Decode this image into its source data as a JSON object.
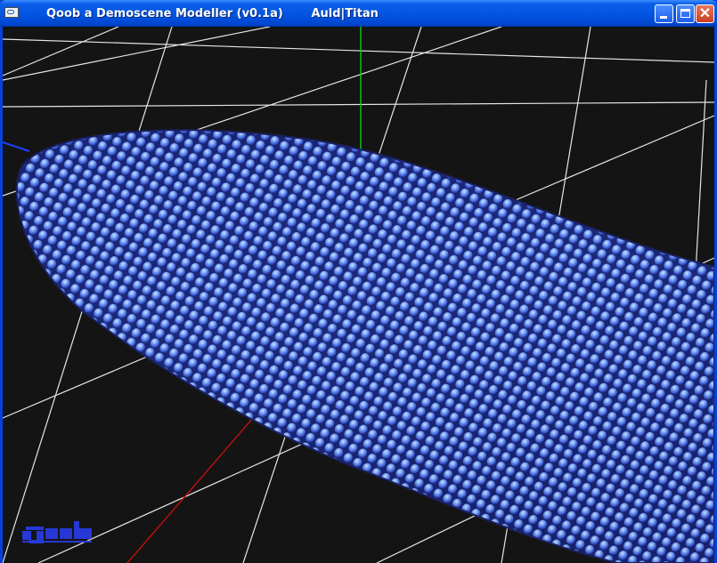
{
  "window": {
    "title": "Qoob a Demoscene Modeller (v0.1a)       Auld|Titan",
    "buttons": {
      "minimize": "minimize",
      "maximize": "maximize",
      "close": "close"
    }
  },
  "viewport": {
    "background": "#141414",
    "grid_color": "#e8e8e8",
    "axis_colors": {
      "x": "#c01010",
      "y": "#10d010",
      "z": "#2040ff"
    },
    "object_color": "#4a6fd8",
    "object_highlight": "#bfe4ff"
  },
  "logo": {
    "text": "qoob",
    "color": "#2638d6"
  }
}
